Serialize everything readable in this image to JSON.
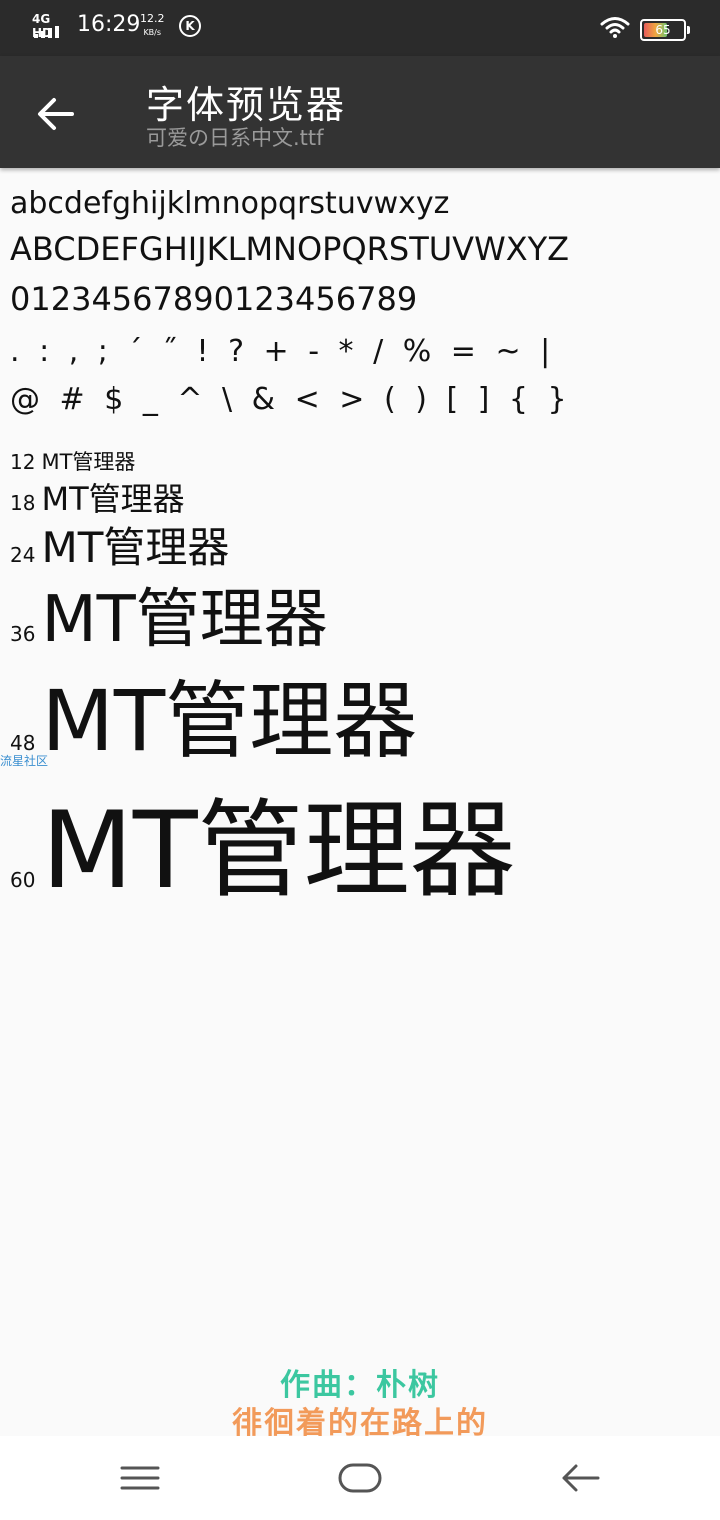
{
  "status_bar": {
    "network": "4G HD",
    "time": "16:29",
    "speed_value": "12.2",
    "speed_unit": "KB/s",
    "k_badge": "K",
    "battery_level": "65",
    "icons": [
      "signal-icon",
      "k-icon",
      "wifi-icon",
      "battery-icon"
    ]
  },
  "app_bar": {
    "title": "字体预览器",
    "subtitle": "可爱の日系中文.ttf",
    "back_icon": "arrow-left-icon"
  },
  "preview": {
    "lowercase": "abcdefghijklmnopqrstuvwxyz",
    "uppercase": "ABCDEFGHIJKLMNOPQRSTUVWXYZ",
    "digits": "01234567890123456789",
    "symbols1": ". : , ; ´ ˝ ! ? + - * / % = ~ |",
    "symbols2": "@ # $ _ ^ \\ & < > ( ) [ ] { }",
    "sample_text": "MT管理器",
    "sizes": [
      "12",
      "18",
      "24",
      "36",
      "48",
      "60"
    ]
  },
  "watermark": "流星社区",
  "lyrics": {
    "line1": "作曲：朴树",
    "line2": "徘徊着的在路上的"
  },
  "nav_bar": {
    "icons": [
      "menu-icon",
      "home-icon",
      "back-icon"
    ]
  },
  "colors": {
    "status_bar_bg": "#2b2b2b",
    "app_bar_bg": "#333333",
    "page_bg": "#fafafa",
    "lyric_line1": "#3cc7a0",
    "lyric_line2": "#f29a5a"
  }
}
